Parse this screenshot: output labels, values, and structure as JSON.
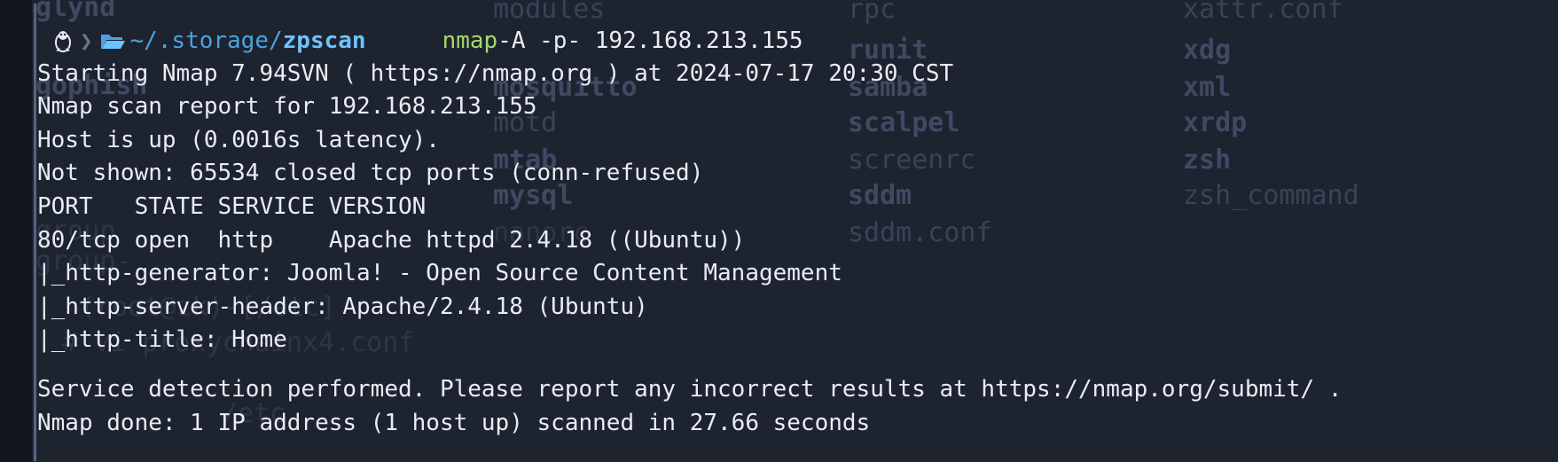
{
  "prompt": {
    "path_prefix": "~/.storage/",
    "path_dir": "zpscan",
    "command": "nmap",
    "args": " -A -p- 192.168.213.155"
  },
  "output": [
    "Starting Nmap 7.94SVN ( https://nmap.org ) at 2024-07-17 20:30 CST",
    "Nmap scan report for 192.168.213.155",
    "Host is up (0.0016s latency).",
    "Not shown: 65534 closed tcp ports (conn-refused)",
    "PORT   STATE SERVICE VERSION",
    "80/tcp open  http    Apache httpd 2.4.18 ((Ubuntu))",
    "|_http-generator: Joomla! - Open Source Content Management",
    "|_http-server-header: Apache/2.4.18 (Ubuntu)",
    "|_http-title: Home"
  ],
  "output_tail": [
    "Service detection performed. Please report any incorrect results at https://nmap.org/submit/ .",
    "Nmap done: 1 IP address (1 host up) scanned in 27.66 seconds"
  ],
  "background_ghost": {
    "col_a": [
      "glynd",
      "group",
      "group-",
      "gophish",
      "gshadow"
    ],
    "col_b": [
      "modules",
      "modules-load.d",
      "mosquitto",
      "motd",
      "mtab",
      "mysql",
      "nanorc"
    ],
    "col_c": [
      "rpc",
      "runit",
      "samba",
      "scalpel",
      "screenrc",
      "sddm",
      "sddm.conf"
    ],
    "col_d": [
      "xattr.conf",
      "xdg",
      "xml",
      "xrdp",
      "zsh",
      "zsh_command"
    ],
    "prompt_fragments": [
      "(root@zk)-[/etc]",
      "# vi proxychainx4.conf",
      "/etc"
    ]
  },
  "colors": {
    "background": "#1e2330",
    "text": "#e8ecf4",
    "command": "#a3d96b",
    "path": "#4aa3e0",
    "path_bold": "#6cc4ff"
  },
  "icons": [
    "linux-tux-icon",
    "chevron-separator-icon",
    "folder-open-icon"
  ]
}
